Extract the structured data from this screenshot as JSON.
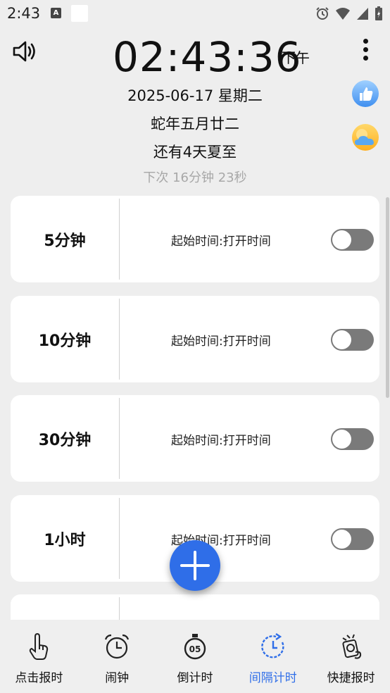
{
  "status_bar": {
    "time": "2:43"
  },
  "header": {
    "clock": "02:43:36",
    "ampm": "下午",
    "date": "2025-06-17 星期二",
    "lunar": "蛇年五月廿二",
    "solar_term": "还有4天夏至",
    "next": "下次  16分钟 23秒"
  },
  "intervals": [
    {
      "title": "5分钟",
      "desc": "起始时间:打开时间",
      "enabled": false
    },
    {
      "title": "10分钟",
      "desc": "起始时间:打开时间",
      "enabled": false
    },
    {
      "title": "30分钟",
      "desc": "起始时间:打开时间",
      "enabled": false
    },
    {
      "title": "1小时",
      "desc": "起始时间:打开时间",
      "enabled": false
    },
    {
      "title": "",
      "desc": "",
      "enabled": false
    }
  ],
  "nav": [
    {
      "label": "点击报时",
      "icon": "tap-hand-icon"
    },
    {
      "label": "闹钟",
      "icon": "alarm-clock-icon"
    },
    {
      "label": "倒计时",
      "icon": "stopwatch-icon"
    },
    {
      "label": "间隔计时",
      "icon": "interval-clock-icon",
      "active": true
    },
    {
      "label": "快捷报时",
      "icon": "quick-report-icon"
    }
  ],
  "colors": {
    "accent": "#2f6ee8",
    "toggle_off": "#7a7a7a",
    "background": "#eeeeee"
  }
}
